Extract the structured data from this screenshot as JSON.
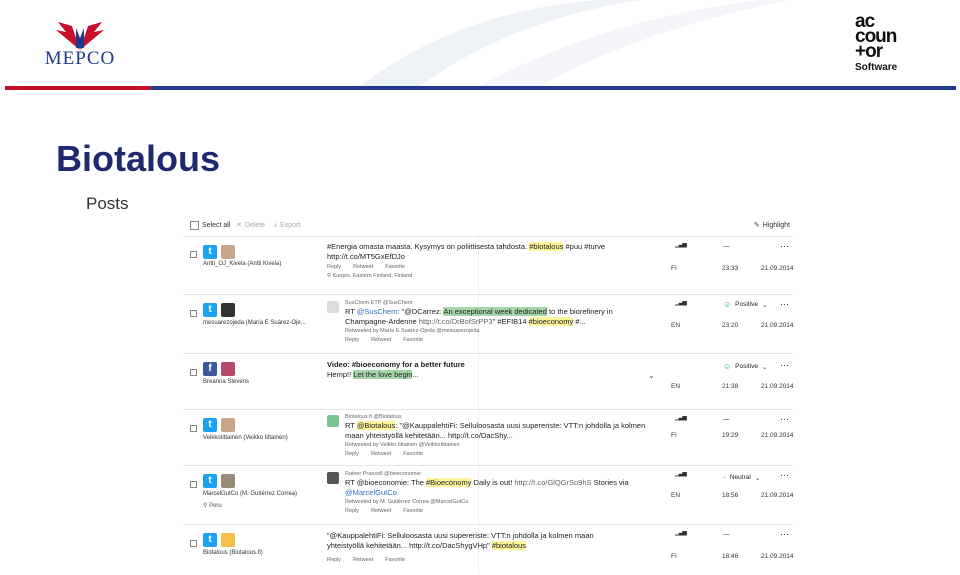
{
  "brand": {
    "left_logo_text": "MEPCO",
    "right_logo_lines": [
      "ac",
      "coun",
      "+or"
    ],
    "right_logo_sub": "Software",
    "colors": {
      "red": "#c8102e",
      "blue": "#1e3a8a"
    }
  },
  "slide": {
    "title": "Biotalous",
    "subtitle": "Posts"
  },
  "toolbar": {
    "select_all": "Select all",
    "delete": "Delete",
    "export": "Export",
    "highlight": "Highlight",
    "icons": {
      "delete": "x-icon",
      "export": "download-icon",
      "highlight": "pen-icon"
    }
  },
  "rows": [
    {
      "service": "twitter",
      "author": "Antti_OJ_Kivela (Antti Kivela)",
      "location": "",
      "text_parts": [
        "#Energia omasta maasta. Kysymys on poliittisesta tahdosta. ",
        "#biotalous",
        " #puu #turve"
      ],
      "text_line2": "http://t.co/MT5GxEfDJo",
      "actions": [
        "Reply",
        "Retweet",
        "Favorite"
      ],
      "place": "Kuopio, Eastern Finland, Finland",
      "lang": "FI",
      "time": "23:33",
      "date": "21.09.2014",
      "sentiment": "—"
    },
    {
      "service": "twitter",
      "author": "mesuarezojeda (María E Suárez-Oje...",
      "quoted_header": "SusChem ETP @SusChem",
      "text_parts": [
        "RT ",
        "@SusChem",
        ": \"@DCarrez: ",
        "An exceptional week dedicated",
        " to the biorefinery in"
      ],
      "text_line2_parts": [
        "Champagne-Ardenne ",
        "http://t.co/DrBofSrPP3",
        "\" #EFIB14 ",
        "#bioeconomy",
        " #..."
      ],
      "retweet_note": "Retweeted by María E Suárez-Ojeda @mesuarezojeda",
      "actions": [
        "Reply",
        "Retweet",
        "Favorite"
      ],
      "lang": "EN",
      "time": "23:20",
      "date": "21.09.2014",
      "sentiment": "Positive"
    },
    {
      "service": "facebook",
      "author": "Breanna Stevens",
      "title": "Video: #bioeconomy for a better future",
      "text_parts": [
        "Hemp!! ",
        "Let the love begin",
        "..."
      ],
      "lang": "EN",
      "time": "21:38",
      "date": "21.09.2014",
      "sentiment": "Positive"
    },
    {
      "service": "twitter",
      "author": "VeikkoIittainen (Veikko Iittainen)",
      "quoted_header": "Biotalous.fi @Biotalous",
      "text_parts": [
        "RT ",
        "@Biotalous",
        ": \"@KauppalehtiFi: Selluloosasta uusi supereriste: VTT:n johdolla ja kolmen"
      ],
      "text_line2": "maan yhteistyöllä kehitetään... http://t.co/DacShy...",
      "retweet_note": "Retweeted by Veikko Iittainen @VeikkoIittainen",
      "actions": [
        "Reply",
        "Retweet",
        "Favorite"
      ],
      "lang": "FI",
      "time": "19:29",
      "date": "21.09.2014",
      "sentiment": "—"
    },
    {
      "service": "twitter",
      "author": "MarcelGutCo (M. Gutiérrez Correa)",
      "location": "Peru",
      "quoted_header": "Rainer Praesoll @bioeconomie",
      "text_parts": [
        "RT @bioeconomie: The ",
        "#Bioeconomy",
        " Daily is out! ",
        "http://t.co/GlQGrSo9hS",
        " Stories via"
      ],
      "text_line2": "@MarcelGutCo",
      "retweet_note": "Retweeted by M. Gutiérrez Correa @MarcelGutCo",
      "actions": [
        "Reply",
        "Retweet",
        "Favorite"
      ],
      "lang": "EN",
      "time": "18:56",
      "date": "21.09.2014",
      "sentiment": "Neutral"
    },
    {
      "service": "twitter",
      "author": "Biotalous (Biotalous.fi)",
      "text_parts": [
        "\"@KauppalehtiFi: Selluloosasta uusi supereriste: VTT:n johdolla ja kolmen maan"
      ],
      "text_line2_parts": [
        "yhteistyöllä kehitetään... http://t.co/DacShygVHp\" ",
        "#biotalous"
      ],
      "actions": [
        "Reply",
        "Retweet",
        "Favorite"
      ],
      "lang": "FI",
      "time": "18:46",
      "date": "21.09.2014",
      "sentiment": "—"
    }
  ]
}
